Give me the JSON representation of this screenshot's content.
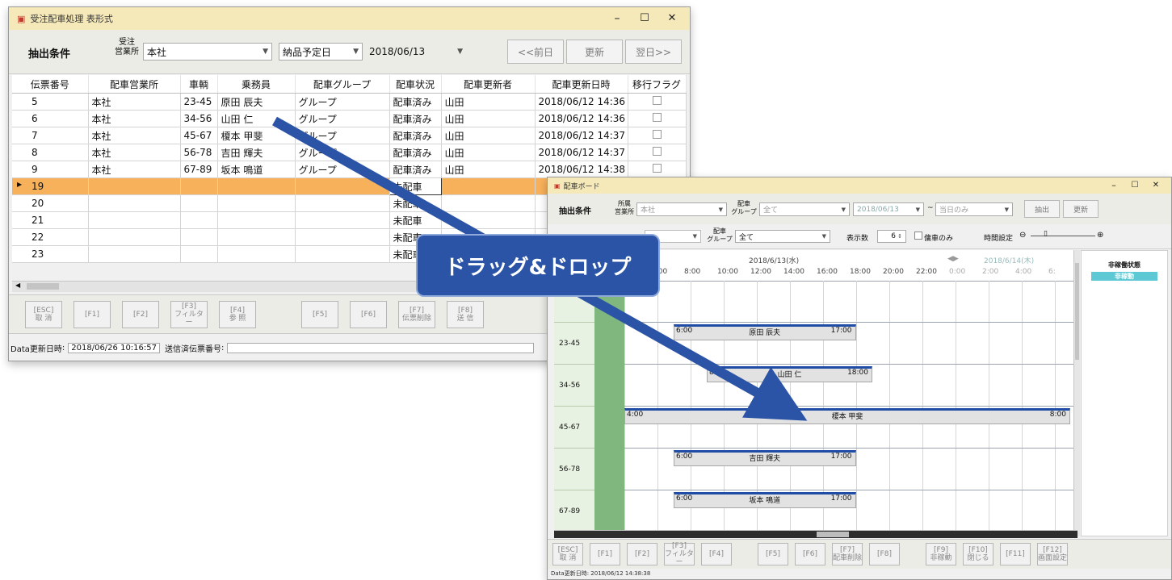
{
  "win1": {
    "title": "受注配車処理 表形式",
    "min": "–",
    "max": "☐",
    "close": "✕",
    "filter_label": "抽出条件",
    "office_label_l1": "受注",
    "office_label_l2": "営業所",
    "office_value": "本社",
    "date_kind": "納品予定日",
    "date_value": "2018/06/13",
    "prev_btn": "<<前日",
    "refresh_btn": "更新",
    "next_btn": "翌日>>",
    "columns": [
      "伝票番号",
      "配車営業所",
      "車輌",
      "乗務員",
      "配車グループ",
      "配車状況",
      "配車更新者",
      "配車更新日時",
      "移行フラグ"
    ],
    "rows": [
      {
        "no": "5",
        "office": "本社",
        "car": "23-45",
        "crew": "原田 辰夫",
        "group": "グループ",
        "status": "配車済み",
        "updater": "山田",
        "updated": "2018/06/12 14:36",
        "flag": true
      },
      {
        "no": "6",
        "office": "本社",
        "car": "34-56",
        "crew": "山田 仁",
        "group": "グループ",
        "status": "配車済み",
        "updater": "山田",
        "updated": "2018/06/12 14:36",
        "flag": true
      },
      {
        "no": "7",
        "office": "本社",
        "car": "45-67",
        "crew": "榎本 甲斐",
        "group": "グループ",
        "status": "配車済み",
        "updater": "山田",
        "updated": "2018/06/12 14:37",
        "flag": true
      },
      {
        "no": "8",
        "office": "本社",
        "car": "56-78",
        "crew": "吉田 輝夫",
        "group": "グループ",
        "status": "配車済み",
        "updater": "山田",
        "updated": "2018/06/12 14:37",
        "flag": true
      },
      {
        "no": "9",
        "office": "本社",
        "car": "67-89",
        "crew": "坂本 鳴道",
        "group": "グループ",
        "status": "配車済み",
        "updater": "山田",
        "updated": "2018/06/12 14:38",
        "flag": true
      },
      {
        "no": "19",
        "office": "",
        "car": "",
        "crew": "",
        "group": "",
        "status": "未配車",
        "updater": "",
        "updated": "",
        "flag": false,
        "selected": true
      },
      {
        "no": "20",
        "office": "",
        "car": "",
        "crew": "",
        "group": "",
        "status": "未配車",
        "updater": "",
        "updated": "",
        "flag": false
      },
      {
        "no": "21",
        "office": "",
        "car": "",
        "crew": "",
        "group": "",
        "status": "未配車",
        "updater": "",
        "updated": "",
        "flag": false
      },
      {
        "no": "22",
        "office": "",
        "car": "",
        "crew": "",
        "group": "",
        "status": "未配車",
        "updater": "",
        "updated": "",
        "flag": false
      },
      {
        "no": "23",
        "office": "",
        "car": "",
        "crew": "",
        "group": "",
        "status": "未配車",
        "updater": "",
        "updated": "",
        "flag": false
      }
    ],
    "fkeys": [
      {
        "k": "[ESC]",
        "l": "取 消"
      },
      {
        "k": "[F1]",
        "l": ""
      },
      {
        "k": "[F2]",
        "l": ""
      },
      {
        "k": "[F3]",
        "l": "フィルター"
      },
      {
        "k": "[F4]",
        "l": "参 照"
      },
      {
        "k": "[F5]",
        "l": ""
      },
      {
        "k": "[F6]",
        "l": ""
      },
      {
        "k": "[F7]",
        "l": "伝票削除"
      },
      {
        "k": "[F8]",
        "l": "送 信"
      }
    ],
    "status_label": "Data更新日時",
    "status_value": "2018/06/26 10:16:57",
    "sent_label": "送信済伝票番号"
  },
  "win2": {
    "title": "配車ボード",
    "filter_label": "抽出条件",
    "office_label_l1": "所属",
    "office_label_l2": "営業所",
    "office_value": "本社",
    "group_label_l1": "配車",
    "group_label_l2": "グループ",
    "group_value": "全て",
    "date_from": "2018/06/13",
    "date_sep": "~",
    "date_to": "当日のみ",
    "extract_btn": "抽出",
    "refresh_btn": "更新",
    "group2_label_l1": "配車",
    "group2_label_l2": "グループ",
    "group2_value": "全て",
    "count_label": "表示数",
    "count_value": "6",
    "vacant_label": "傭車のみ",
    "time_label": "時間設定",
    "day1": "2018/6/13(水)",
    "day2": "2018/6/14(木)",
    "hours": [
      "6:00",
      "8:00",
      "10:00",
      "12:00",
      "14:00",
      "16:00",
      "18:00",
      "20:00",
      "22:00",
      "0:00",
      "2:00",
      "4:00",
      "6:"
    ],
    "side_title": "非稼働状態",
    "side_value": "非稼動",
    "rows": [
      {
        "car": ""
      },
      {
        "car": "23-45"
      },
      {
        "car": "34-56"
      },
      {
        "car": "45-67"
      },
      {
        "car": "56-78"
      },
      {
        "car": "67-89"
      }
    ],
    "bars": [
      {
        "row": 1,
        "start": "6:00",
        "crew": "原田 辰夫",
        "end": "17:00"
      },
      {
        "row": 2,
        "start": "8:00",
        "crew": "山田 仁",
        "end": "18:00"
      },
      {
        "row": 3,
        "start": "4:00",
        "crew": "榎本 甲斐",
        "end": "8:00"
      },
      {
        "row": 4,
        "start": "6:00",
        "crew": "吉田 輝夫",
        "end": "17:00"
      },
      {
        "row": 5,
        "start": "6:00",
        "crew": "坂本 鳴道",
        "end": "17:00"
      }
    ],
    "fkeys": [
      {
        "k": "[ESC]",
        "l": "取 消"
      },
      {
        "k": "[F1]",
        "l": ""
      },
      {
        "k": "[F2]",
        "l": ""
      },
      {
        "k": "[F3]",
        "l": "フィルター"
      },
      {
        "k": "[F4]",
        "l": ""
      },
      {
        "k": "[F5]",
        "l": ""
      },
      {
        "k": "[F6]",
        "l": ""
      },
      {
        "k": "[F7]",
        "l": "配車削除"
      },
      {
        "k": "[F8]",
        "l": ""
      },
      {
        "k": "[F9]",
        "l": "非稼動"
      },
      {
        "k": "[F10]",
        "l": "閉じる"
      },
      {
        "k": "[F11]",
        "l": ""
      },
      {
        "k": "[F12]",
        "l": "画面設定"
      }
    ],
    "status_text": "Data更新日時: 2018/06/12 14:38:38"
  },
  "callout": "ドラッグ&ドロップ",
  "colors": {
    "accent": "#2b53a6",
    "selected_row": "#f8b15b",
    "bar_top": "#1f4da5",
    "row_label": "#7fb77e",
    "titlebar": "#f6e9b9"
  }
}
